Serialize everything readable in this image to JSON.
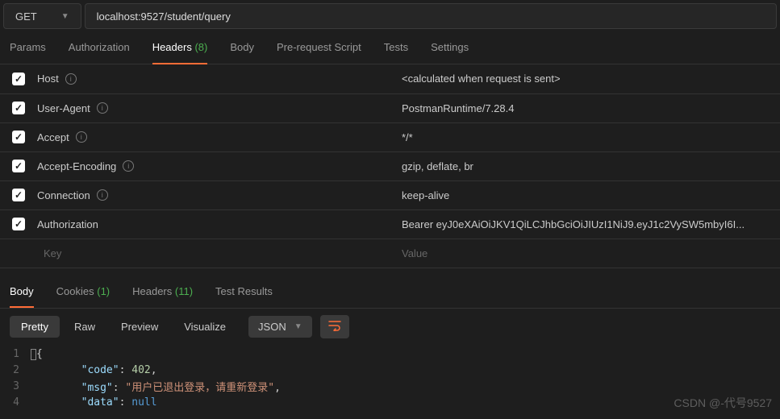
{
  "request": {
    "method": "GET",
    "url": "localhost:9527/student/query"
  },
  "reqTabs": {
    "params": "Params",
    "authorization": "Authorization",
    "headers": "Headers",
    "headersCount": "(8)",
    "body": "Body",
    "preRequest": "Pre-request Script",
    "tests": "Tests",
    "settings": "Settings"
  },
  "headers": [
    {
      "key": "Host",
      "value": "<calculated when request is sent>",
      "info": true
    },
    {
      "key": "User-Agent",
      "value": "PostmanRuntime/7.28.4",
      "info": true
    },
    {
      "key": "Accept",
      "value": "*/*",
      "info": true
    },
    {
      "key": "Accept-Encoding",
      "value": "gzip, deflate, br",
      "info": true
    },
    {
      "key": "Connection",
      "value": "keep-alive",
      "info": true
    },
    {
      "key": "Authorization",
      "value": "Bearer eyJ0eXAiOiJKV1QiLCJhbGciOiJIUzI1NiJ9.eyJ1c2VySW5mbyI6I...",
      "info": false
    }
  ],
  "headerPlaceholder": {
    "key": "Key",
    "value": "Value"
  },
  "resTabs": {
    "body": "Body",
    "cookies": "Cookies",
    "cookiesCount": "(1)",
    "headers": "Headers",
    "headersCount": "(11)",
    "testResults": "Test Results"
  },
  "viewModes": {
    "pretty": "Pretty",
    "raw": "Raw",
    "preview": "Preview",
    "visualize": "Visualize",
    "format": "JSON"
  },
  "responseBody": {
    "line2_key": "\"code\"",
    "line2_val": "402",
    "line3_key": "\"msg\"",
    "line3_val": "\"用户已退出登录，请重新登录\"",
    "line4_key": "\"data\"",
    "line4_val": "null"
  },
  "watermark": "CSDN @-代号9527"
}
